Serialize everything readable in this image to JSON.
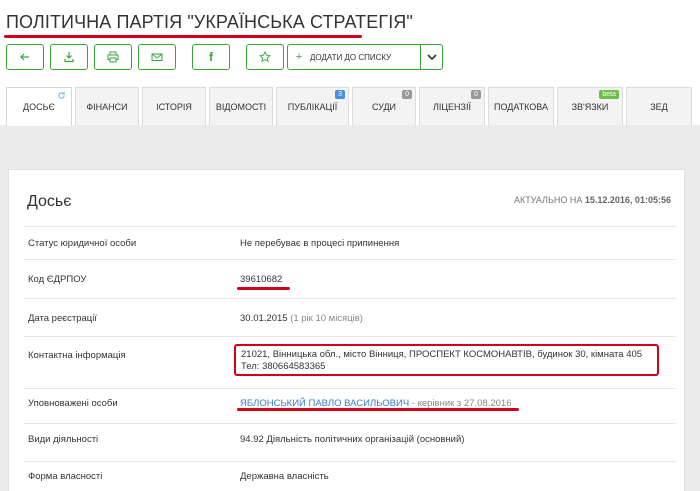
{
  "title": "ПОЛІТИЧНА ПАРТІЯ \"УКРАЇНСЬКА СТРАТЕГІЯ\"",
  "toolbar": {
    "back_icon": "arrow-left-icon",
    "download_icon": "download-icon",
    "print_icon": "print-icon",
    "email_icon": "envelope-icon",
    "facebook_glyph": "f",
    "star_icon": "star-icon",
    "add_to_list_label": "ДОДАТИ ДО СПИСКУ",
    "add_plus": "+"
  },
  "tabs": [
    {
      "label": "ДОСЬЄ",
      "active": true
    },
    {
      "label": "ФІНАНСИ"
    },
    {
      "label": "ІСТОРІЯ"
    },
    {
      "label": "ВІДОМОСТІ"
    },
    {
      "label": "ПУБЛІКАЦІЇ",
      "badge": "3"
    },
    {
      "label": "СУДИ",
      "badge": "0"
    },
    {
      "label": "ЛІЦЕНЗІЇ",
      "badge": "0"
    },
    {
      "label": "ПОДАТКОВА"
    },
    {
      "label": "ЗВ'ЯЗКИ",
      "badge": "beta"
    },
    {
      "label": "ЗЕД"
    }
  ],
  "dossier": {
    "heading": "Досьє",
    "actual_prefix": "АКТУАЛЬНО НА",
    "actual_date": "15.12.2016, 01:05:56"
  },
  "rows": [
    {
      "key": "Статус юридичної особи",
      "value": "Не перебуває в процесі припинення"
    },
    {
      "key": "Код ЄДРПОУ",
      "value": "39610682"
    },
    {
      "key": "Дата реєстрації",
      "value": "30.01.2015",
      "extra": "(1 рік 10 місяців)"
    },
    {
      "key": "Контактна інформація",
      "value": "21021, Вінницька обл., місто Вінниця, ПРОСПЕКТ КОСМОНАВТІВ, будинок 30, кімната 405",
      "phone_label": "Тел:",
      "phone": "380664583365"
    },
    {
      "key": "Уповноважені особи",
      "value": "ЯБЛОНСЬКИЙ ПАВЛО ВАСИЛЬОВИЧ",
      "extra": "- керівник з 27.08.2016"
    },
    {
      "key": "Види діяльності",
      "value": "94.92 Діяльність політичних організацій (основний)"
    },
    {
      "key": "Форма власності",
      "value": "Державна власність"
    }
  ],
  "colors": {
    "accent_green": "#3aa63a",
    "annotation_red": "#d0021b",
    "link_blue": "#3a7dc9"
  }
}
